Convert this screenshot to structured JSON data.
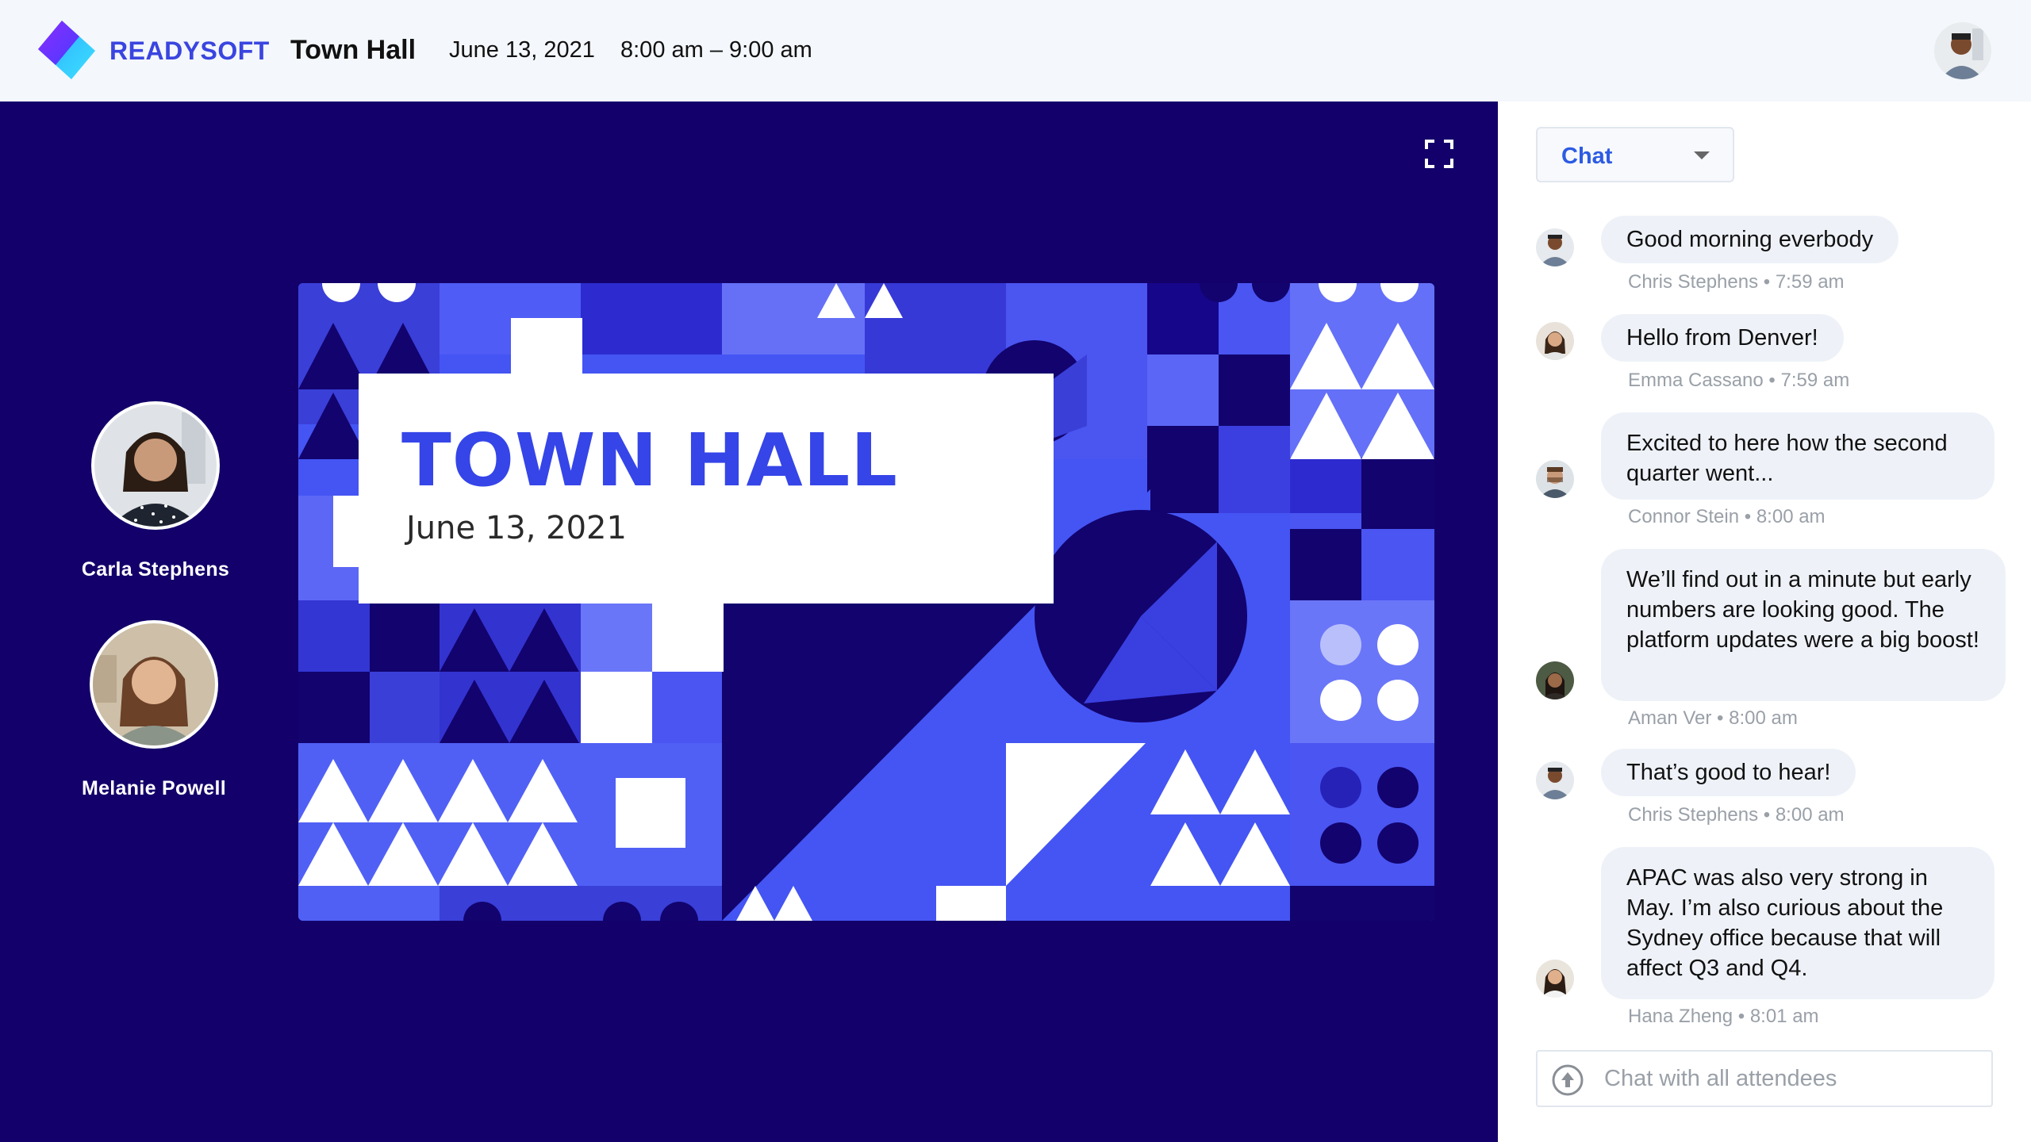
{
  "header": {
    "brand": "READYSOFT",
    "event_title": "Town Hall",
    "date": "June 13, 2021",
    "time": "8:00 am – 9:00 am"
  },
  "presenters": [
    {
      "name": "Carla Stephens"
    },
    {
      "name": "Melanie Powell"
    }
  ],
  "slide": {
    "title": "TOWN HALL",
    "date": "June 13, 2021"
  },
  "chat": {
    "selector_label": "Chat",
    "input_placeholder": "Chat with all attendees",
    "messages": [
      {
        "text": "Good morning everbody",
        "meta": "Chris Stephens • 7:59 am"
      },
      {
        "text": "Hello from Denver!",
        "meta": "Emma Cassano • 7:59 am"
      },
      {
        "text": "Excited to here how the second quarter went...",
        "meta": "Connor Stein • 8:00 am"
      },
      {
        "text": "We’ll find out in a minute but early numbers are looking good. The platform updates were a big boost!",
        "meta": "Aman Ver • 8:00 am"
      },
      {
        "text": "That’s good to hear!",
        "meta": "Chris Stephens • 8:00 am"
      },
      {
        "text": "APAC was also very strong in May. I’m also curious about the Sydney office because that will affect Q3 and Q4.",
        "meta": "Hana Zheng • 8:01 am"
      }
    ]
  },
  "colors": {
    "brand": "#3a45e0",
    "stage_bg": "#13006a",
    "slide_accent": "#3545e8",
    "chat_link": "#2d5be3"
  },
  "icons": [
    "readysoft-logo-icon",
    "fullscreen-icon",
    "chevron-down-icon",
    "send-icon"
  ]
}
